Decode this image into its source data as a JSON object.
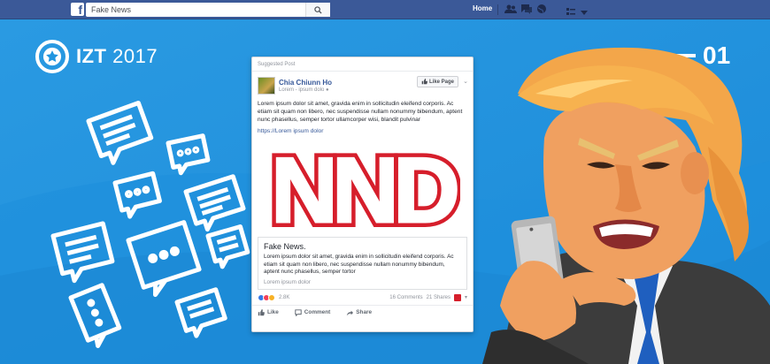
{
  "topbar": {
    "logo": "f",
    "search_placeholder": "Fake News",
    "home_label": "Home"
  },
  "brand": {
    "name": "IZT",
    "year": "2017"
  },
  "page_number": "01",
  "post": {
    "suggested_label": "Suggested Post",
    "author": "Chia Chiunn Ho",
    "sub_line": "Lorem - ipsum dolo",
    "like_page_label": "Like Page",
    "body": "Lorem ipsum dolor sit amet, gravida enim in sollicitudin eleifend corporis. Ac etiam sit quam non libero, nec suspendisse nullam nonummy bibendum, aptent nunc phasellus, semper tortor ullamcorper wisi, blandit pulvinar",
    "link_url": "https://Lorem ipsum dolor",
    "image_logo": "NND",
    "link_title": "Fake News.",
    "link_desc": "Lorem ipsum dolor sit amet, gravida enim in sollicitudin eleifend corporis. Ac etiam sit quam non libero, nec suspendisse nullam nonummy bibendum, aptent nunc phasellus, semper tortor",
    "link_domain": "Lorem ipsum dolor",
    "reaction_count": "2.8K",
    "comments": "16 Comments",
    "shares": "21 Shares",
    "actions": {
      "like": "Like",
      "comment": "Comment",
      "share": "Share"
    }
  },
  "colors": {
    "background": "#2196e0",
    "facebook_blue": "#3b5998",
    "logo_red": "#d61e2b"
  }
}
